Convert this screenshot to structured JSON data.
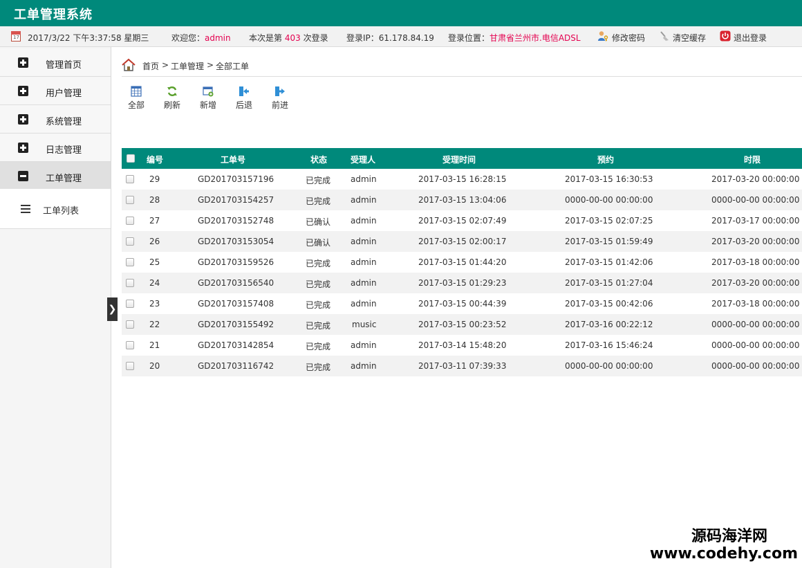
{
  "app": {
    "title": "工单管理系统"
  },
  "info_bar": {
    "datetime": "2017/3/22 下午3:37:58 星期三",
    "welcome_label": "欢迎您：",
    "username": "admin",
    "login_prefix": "本次是第",
    "login_count": "403",
    "login_suffix": "次登录",
    "ip_label": "登录IP：61.178.84.19",
    "location_label": "登录位置：",
    "location_value": "甘肃省兰州市.电信ADSL",
    "change_password": "修改密码",
    "clear_cache": "清空缓存",
    "logout": "退出登录"
  },
  "sidebar": {
    "items": [
      {
        "label": "管理首页"
      },
      {
        "label": "用户管理"
      },
      {
        "label": "系统管理"
      },
      {
        "label": "日志管理"
      },
      {
        "label": "工单管理"
      }
    ],
    "sub_item": {
      "label": "工单列表"
    },
    "toggle": "❯"
  },
  "breadcrumb": {
    "home": "首页",
    "sep": ">",
    "level2": "工单管理",
    "level3": "全部工单"
  },
  "toolbar": {
    "all": "全部",
    "refresh": "刷新",
    "add": "新增",
    "back": "后退",
    "forward": "前进"
  },
  "table": {
    "headers": {
      "id": "编号",
      "order_no": "工单号",
      "status": "状态",
      "handler": "受理人",
      "accept_time": "受理时间",
      "appointment": "预约",
      "deadline": "时限"
    },
    "rows": [
      {
        "id": "29",
        "order_no": "GD201703157196",
        "status": "已完成",
        "handler": "admin",
        "accept_time": "2017-03-15 16:28:15",
        "appointment": "2017-03-15 16:30:53",
        "deadline": "2017-03-20 00:00:00"
      },
      {
        "id": "28",
        "order_no": "GD201703154257",
        "status": "已完成",
        "handler": "admin",
        "accept_time": "2017-03-15 13:04:06",
        "appointment": "0000-00-00 00:00:00",
        "deadline": "0000-00-00 00:00:00"
      },
      {
        "id": "27",
        "order_no": "GD201703152748",
        "status": "已确认",
        "handler": "admin",
        "accept_time": "2017-03-15 02:07:49",
        "appointment": "2017-03-15 02:07:25",
        "deadline": "2017-03-17 00:00:00"
      },
      {
        "id": "26",
        "order_no": "GD201703153054",
        "status": "已确认",
        "handler": "admin",
        "accept_time": "2017-03-15 02:00:17",
        "appointment": "2017-03-15 01:59:49",
        "deadline": "2017-03-20 00:00:00"
      },
      {
        "id": "25",
        "order_no": "GD201703159526",
        "status": "已完成",
        "handler": "admin",
        "accept_time": "2017-03-15 01:44:20",
        "appointment": "2017-03-15 01:42:06",
        "deadline": "2017-03-18 00:00:00"
      },
      {
        "id": "24",
        "order_no": "GD201703156540",
        "status": "已完成",
        "handler": "admin",
        "accept_time": "2017-03-15 01:29:23",
        "appointment": "2017-03-15 01:27:04",
        "deadline": "2017-03-20 00:00:00"
      },
      {
        "id": "23",
        "order_no": "GD201703157408",
        "status": "已完成",
        "handler": "admin",
        "accept_time": "2017-03-15 00:44:39",
        "appointment": "2017-03-15 00:42:06",
        "deadline": "2017-03-18 00:00:00"
      },
      {
        "id": "22",
        "order_no": "GD201703155492",
        "status": "已完成",
        "handler": "music",
        "accept_time": "2017-03-15 00:23:52",
        "appointment": "2017-03-16 00:22:12",
        "deadline": "0000-00-00 00:00:00"
      },
      {
        "id": "21",
        "order_no": "GD201703142854",
        "status": "已完成",
        "handler": "admin",
        "accept_time": "2017-03-14 15:48:20",
        "appointment": "2017-03-16 15:46:24",
        "deadline": "0000-00-00 00:00:00"
      },
      {
        "id": "20",
        "order_no": "GD201703116742",
        "status": "已完成",
        "handler": "admin",
        "accept_time": "2017-03-11 07:39:33",
        "appointment": "0000-00-00 00:00:00",
        "deadline": "0000-00-00 00:00:00"
      }
    ]
  },
  "watermark": {
    "line1": "源码海洋网",
    "line2": "www.codehy.com"
  },
  "colors": {
    "brand": "#00897b",
    "highlight": "#e4004f"
  }
}
